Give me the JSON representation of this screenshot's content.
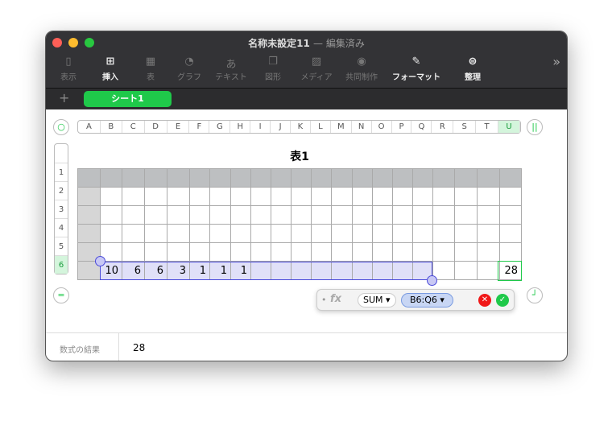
{
  "window": {
    "title": "名称未設定11",
    "status": "— 編集済み"
  },
  "toolbar": [
    {
      "label": "表示",
      "icon": "sidebar-icon",
      "on": false
    },
    {
      "label": "挿入",
      "icon": "insert-icon",
      "on": true
    },
    {
      "label": "表",
      "icon": "table-icon",
      "on": false
    },
    {
      "label": "グラフ",
      "icon": "chart-icon",
      "on": false
    },
    {
      "label": "テキスト",
      "icon": "text-icon",
      "on": false
    },
    {
      "label": "図形",
      "icon": "shape-icon",
      "on": false
    },
    {
      "label": "メディア",
      "icon": "media-icon",
      "on": false
    },
    {
      "label": "共同制作",
      "icon": "collaborate-icon",
      "on": false
    },
    {
      "label": "フォーマット",
      "icon": "format-icon",
      "on": true
    },
    {
      "label": "整理",
      "icon": "organize-icon",
      "on": true
    }
  ],
  "tabs": {
    "add": "+",
    "sheet": "シート1"
  },
  "columns": [
    "A",
    "B",
    "C",
    "D",
    "E",
    "F",
    "G",
    "H",
    "I",
    "J",
    "K",
    "L",
    "M",
    "N",
    "O",
    "P",
    "Q",
    "R",
    "S",
    "T",
    "U"
  ],
  "rows": [
    "1",
    "2",
    "3",
    "4",
    "5",
    "6"
  ],
  "table": {
    "title": "表1",
    "row6": [
      "",
      "10",
      "6",
      "6",
      "3",
      "1",
      "1",
      "1",
      "",
      "",
      "",
      "",
      "",
      "",
      "",
      "",
      "",
      "",
      "",
      "",
      "28"
    ]
  },
  "formula": {
    "fx": "fx",
    "func": "SUM ▾",
    "range": "B6:Q6 ▾"
  },
  "footer": {
    "label": "数式の結果",
    "value": "28"
  }
}
